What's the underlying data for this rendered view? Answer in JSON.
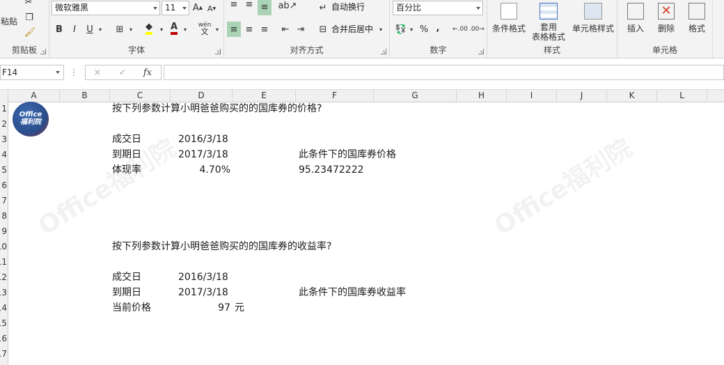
{
  "ribbon": {
    "clipboard": {
      "label": "剪贴板",
      "paste_label": "粘贴"
    },
    "font": {
      "label": "字体",
      "font_name": "微软雅黑",
      "font_size": "11",
      "bold": "B",
      "italic": "I",
      "underline": "U"
    },
    "alignment": {
      "label": "对齐方式",
      "wrap_text": "自动换行",
      "merge_center": "合并后居中"
    },
    "number": {
      "label": "数字",
      "format": "百分比",
      "percent": "%",
      "comma": ",",
      "inc_decimal": ".00",
      "dec_decimal": ".00"
    },
    "styles": {
      "label": "样式",
      "conditional": "条件格式",
      "table_format_1": "套用",
      "table_format_2": "表格格式",
      "cell_styles": "单元格样式"
    },
    "cells": {
      "label": "单元格",
      "insert": "插入",
      "delete": "删除",
      "format": "格式"
    }
  },
  "formula_bar": {
    "name_box": "F14",
    "fx": "fx",
    "cancel": "×",
    "enter": "✓",
    "value": ""
  },
  "columns": [
    "A",
    "B",
    "C",
    "D",
    "E",
    "F",
    "G",
    "H",
    "I",
    "J",
    "K",
    "L"
  ],
  "rows": [
    "1",
    "2",
    "3",
    "4",
    "5",
    "6",
    "7",
    "8",
    "9",
    "10",
    "11",
    "12",
    "13",
    "14",
    "15",
    "16",
    "17"
  ],
  "logo": {
    "line1": "Office",
    "line2": "福利院"
  },
  "sheet": {
    "q1_title": "按下列参数计算小明爸爸购买的的国库券的价格?",
    "trade_date_label": "成交日",
    "trade_date_1": "2016/3/18",
    "maturity_label": "到期日",
    "maturity_1": "2017/3/18",
    "price_result_label": "此条件下的国库券价格",
    "discount_label": "体现率",
    "discount_value": "4.70%",
    "price_result_value": "95.23472222",
    "q2_title": "按下列参数计算小明爸爸购买的的国库券的收益率?",
    "trade_date_2": "2016/3/18",
    "maturity_2": "2017/3/18",
    "yield_result_label": "此条件下的国库券收益率",
    "current_price_label": "当前价格",
    "current_price_value": "97",
    "unit": "元"
  },
  "watermark": "Office福利院",
  "colors": {
    "ribbon_bg": "#f3f3f3",
    "accent": "#217346",
    "logo_bg": "#2a4e8c"
  }
}
